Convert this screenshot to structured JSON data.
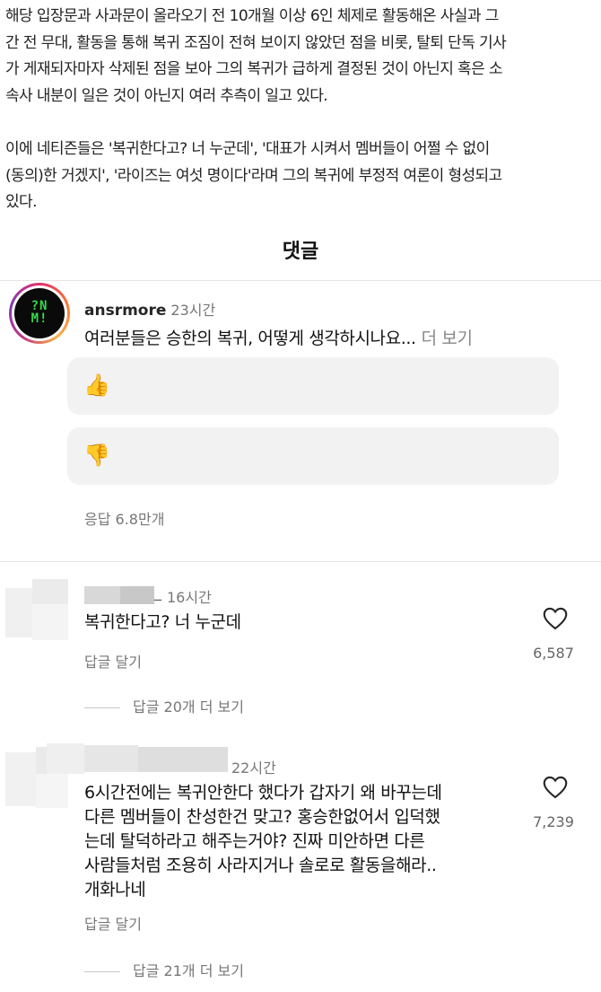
{
  "article": {
    "paragraph1_lines": [
      "해당 입장문과 사과문이 올라오기 전 10개월 이상 6인 체제로 활동해온 사실과 그",
      "간 전 무대, 활동을 통해 복귀 조짐이 전혀 보이지 않았던 점을 비롯, 탈퇴 단독 기사",
      "가 게재되자마자 삭제된 점을 보아 그의 복귀가 급하게 결정된 것이 아닌지 혹은 소",
      "속사 내분이 일은 것이 아닌지 여러 추측이 일고 있다."
    ],
    "paragraph2_lines": [
      "이에 네티즌들은 '복귀한다고? 너 누군데', '대표가 시켜서 멤버들이 어쩔 수 없이",
      "(동의)한 거겠지', '라이즈는 여섯 명이다'라며 그의 복귀에 부정적 여론이 형성되고",
      "있다."
    ]
  },
  "comments_section": {
    "title": "댓글",
    "post": {
      "avatar_text_line1": "?N",
      "avatar_text_line2": "M!",
      "username": "ansrmore",
      "time": "23시간",
      "text": "여러분들은 승한의 복귀, 어떻게 생각하시나요...",
      "more_label": "더 보기",
      "vote_up_icon": "thumbs-up-icon",
      "vote_up_glyph": "👍",
      "vote_down_icon": "thumbs-down-icon",
      "vote_down_glyph": "👎",
      "replies_label": "응답 6.8만개"
    },
    "comments": [
      {
        "username_suffix": "_",
        "time": "16시간",
        "text_lines": [
          "복귀한다고? 너 누군데"
        ],
        "reply_label": "답글 달기",
        "likes": "6,587",
        "view_replies_label": "답글 20개 더 보기"
      },
      {
        "time": "22시간",
        "text_lines": [
          "6시간전에는 복귀안한다 했다가 갑자기 왜 바꾸는데",
          "다른 멤버들이 찬성한건 맞고? 홍승한없어서 입덕했",
          "는데 탈덕하라고 해주는거야? 진짜 미안하면 다른",
          "사람들처럼 조용히 사라지거나 솔로로 활동을해라..",
          "개화나네"
        ],
        "reply_label": "답글 달기",
        "likes": "7,239",
        "view_replies_label": "답글 21개 더 보기"
      }
    ]
  },
  "colors": {
    "accent_ring": "#e1306c",
    "logo_green": "#38d94a",
    "muted_text": "#777777",
    "vote_box_bg": "#f2f2f2"
  }
}
